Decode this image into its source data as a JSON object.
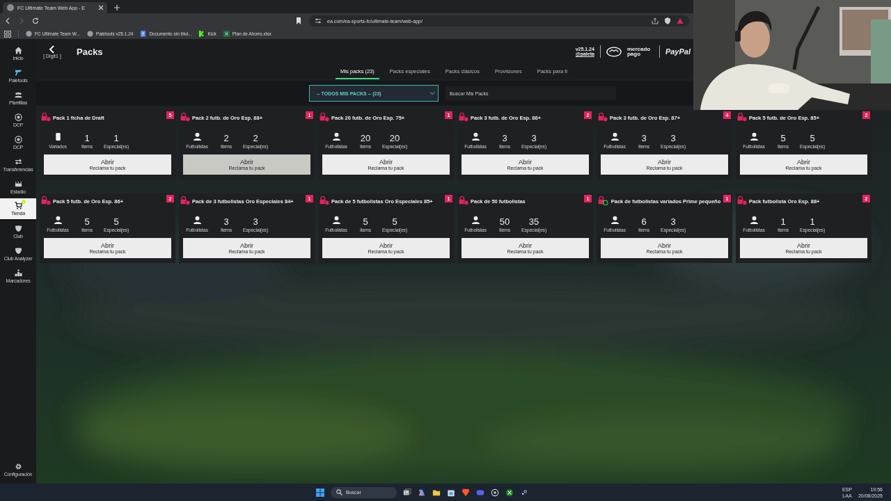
{
  "browser": {
    "tab_title": "FC Ultimate Team Web App - E",
    "url": "ea.com/ea-sports-fc/ultimate-team/web-app/",
    "bookmarks": [
      {
        "label": "FC Ultimate Team W...",
        "kind": "globe"
      },
      {
        "label": "Paletools v25.1.24",
        "kind": "globe"
      },
      {
        "label": "Documento sin títul...",
        "kind": "doc"
      },
      {
        "label": "Kick",
        "kind": "kick"
      },
      {
        "label": "Plan de Ahorro.xlsx",
        "kind": "sheet"
      }
    ]
  },
  "sidebar": {
    "items": [
      {
        "label": "Inicio",
        "kind": "home",
        "selected": false
      },
      {
        "label": "Paletools",
        "kind": "logo",
        "selected": false
      },
      {
        "label": "Plantillas",
        "kind": "people",
        "selected": false
      },
      {
        "label": "DCP",
        "kind": "ball",
        "selected": false
      },
      {
        "label": "DCP",
        "kind": "ball",
        "selected": false
      },
      {
        "label": "Transferencias",
        "kind": "arrows",
        "selected": false
      },
      {
        "label": "Estadio",
        "kind": "stadium",
        "selected": false
      },
      {
        "label": "Tienda",
        "kind": "cart",
        "selected": true
      },
      {
        "label": "Club",
        "kind": "shield",
        "selected": false
      },
      {
        "label": "Club Analyzer",
        "kind": "shield",
        "selected": false
      },
      {
        "label": "Marcadores",
        "kind": "podium",
        "selected": false
      }
    ],
    "settings": "Configuración"
  },
  "header": {
    "back_hint": "[ Digit1 ]",
    "title": "Packs",
    "version": "v25.1.24",
    "user": "@paleta",
    "brand_1": "mercado pago",
    "brand_2": "PayPal"
  },
  "tabs": [
    {
      "label": "Mis packs (23)",
      "selected": true
    },
    {
      "label": "Packs especiales",
      "selected": false
    },
    {
      "label": "Packs clásicos",
      "selected": false
    },
    {
      "label": "Provisiones",
      "selected": false
    },
    {
      "label": "Packs para ti",
      "selected": false
    }
  ],
  "filter": {
    "value": "-- TODOS MIS PACKS -- (23)",
    "search_placeholder": "Buscar Mis Packs"
  },
  "packs": [
    {
      "title": "Pack 1 ficha de Draft",
      "count": "5",
      "lock": {
        "kind": "standard"
      },
      "content": {
        "kind": "card",
        "label": "Variados"
      },
      "stats": [
        {
          "value": "1",
          "label": "Items"
        },
        {
          "value": "1",
          "label": "Especial(es)"
        }
      ],
      "button": "Abrir",
      "button_sub": "Reclama tu pack",
      "hovered": false
    },
    {
      "title": "Pack 2 futb. de Oro Esp. 88+",
      "count": "1",
      "lock": {
        "kind": "standard"
      },
      "content": {
        "kind": "person",
        "label": "Futbolistas"
      },
      "stats": [
        {
          "value": "2",
          "label": "Items"
        },
        {
          "value": "2",
          "label": "Especial(es)"
        }
      ],
      "button": "Abrir",
      "button_sub": "Reclama tu pack",
      "hovered": true
    },
    {
      "title": "Pack 20 futb. de Oro Esp. 75+",
      "count": "1",
      "lock": {
        "kind": "standard"
      },
      "content": {
        "kind": "person",
        "label": "Futbolistas"
      },
      "stats": [
        {
          "value": "20",
          "label": "Items"
        },
        {
          "value": "20",
          "label": "Especial(es)"
        }
      ],
      "button": "Abrir",
      "button_sub": "Reclama tu pack",
      "hovered": false
    },
    {
      "title": "Pack 3 futb. de Oro Esp. 86+",
      "count": "2",
      "lock": {
        "kind": "standard"
      },
      "content": {
        "kind": "person",
        "label": "Futbolistas"
      },
      "stats": [
        {
          "value": "3",
          "label": "Items"
        },
        {
          "value": "3",
          "label": "Especial(es)"
        }
      ],
      "button": "Abrir",
      "button_sub": "Reclama tu pack",
      "hovered": false
    },
    {
      "title": "Pack 3 futb. de Oro Esp. 87+",
      "count": "4",
      "lock": {
        "kind": "standard"
      },
      "content": {
        "kind": "person",
        "label": "Futbolistas"
      },
      "stats": [
        {
          "value": "3",
          "label": "Items"
        },
        {
          "value": "3",
          "label": "Especial(es)"
        }
      ],
      "button": "Abrir",
      "button_sub": "Reclama tu pack",
      "hovered": false
    },
    {
      "title": "Pack 5 futb. de Oro Esp. 85+",
      "count": "2",
      "lock": {
        "kind": "standard"
      },
      "content": {
        "kind": "person",
        "label": "Futbolistas"
      },
      "stats": [
        {
          "value": "5",
          "label": "Items"
        },
        {
          "value": "5",
          "label": "Especial(es)"
        }
      ],
      "button": "Abrir",
      "button_sub": "Reclama tu pack",
      "hovered": false
    },
    {
      "title": "Pack 5 futb. de Oro Esp. 86+",
      "count": "2",
      "lock": {
        "kind": "standard"
      },
      "content": {
        "kind": "person",
        "label": "Futbolistas"
      },
      "stats": [
        {
          "value": "5",
          "label": "Items"
        },
        {
          "value": "5",
          "label": "Especial(es)"
        }
      ],
      "button": "Abrir",
      "button_sub": "Reclama tu pack",
      "hovered": false
    },
    {
      "title": "Pack de 3 futbolistas Oro Especiales 84+",
      "count": "1",
      "lock": {
        "kind": "standard"
      },
      "content": {
        "kind": "person",
        "label": "Futbolistas"
      },
      "stats": [
        {
          "value": "3",
          "label": "Items"
        },
        {
          "value": "3",
          "label": "Especial(es)"
        }
      ],
      "button": "Abrir",
      "button_sub": "Reclama tu pack",
      "hovered": false
    },
    {
      "title": "Pack de 5 futbolistas Oro Especiales 85+",
      "count": "1",
      "lock": {
        "kind": "standard"
      },
      "content": {
        "kind": "person",
        "label": "Futbolistas"
      },
      "stats": [
        {
          "value": "5",
          "label": "Items"
        },
        {
          "value": "5",
          "label": "Especial(es)"
        }
      ],
      "button": "Abrir",
      "button_sub": "Reclama tu pack",
      "hovered": false
    },
    {
      "title": "Pack de 50 futbolistas",
      "count": "1",
      "lock": {
        "kind": "standard"
      },
      "content": {
        "kind": "person",
        "label": "Futbolistas"
      },
      "stats": [
        {
          "value": "50",
          "label": "Items"
        },
        {
          "value": "35",
          "label": "Especial(es)"
        }
      ],
      "button": "Abrir",
      "button_sub": "Reclama tu pack",
      "hovered": false
    },
    {
      "title": "Pack de futbolistas variados Prime pequeño",
      "count": "1",
      "lock": {
        "kind": "prime"
      },
      "content": {
        "kind": "person",
        "label": "Futbolistas"
      },
      "stats": [
        {
          "value": "6",
          "label": "Items"
        },
        {
          "value": "3",
          "label": "Especial(es)"
        }
      ],
      "button": "Abrir",
      "button_sub": "Reclama tu pack",
      "hovered": false
    },
    {
      "title": "Pack futbolista Oro Esp. 88+",
      "count": "2",
      "lock": {
        "kind": "standard"
      },
      "content": {
        "kind": "person",
        "label": "Futbolistas"
      },
      "stats": [
        {
          "value": "1",
          "label": "Items"
        },
        {
          "value": "1",
          "label": "Especial(es)"
        }
      ],
      "button": "Abrir",
      "button_sub": "Reclama tu pack",
      "hovered": false
    }
  ],
  "taskbar": {
    "search_placeholder": "Buscar",
    "language": "ESP",
    "layout": "LAA",
    "time": "19:56",
    "date": "20/08/2025"
  }
}
